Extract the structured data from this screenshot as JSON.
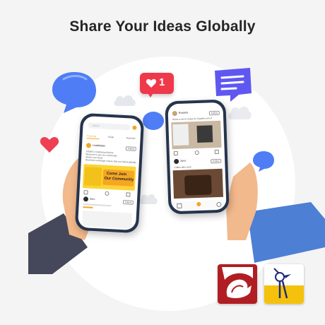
{
  "headline": "Share Your Ideas Globally",
  "colors": {
    "accent_orange": "#f5a623",
    "heart_red": "#f0384b",
    "bubble_blue": "#4f7df5",
    "chat_purple": "#5f58f0",
    "phone_frame": "#26344d"
  },
  "like_badge": {
    "count": "1"
  },
  "left_phone": {
    "search_placeholder": "Search",
    "tabs": [
      "Following",
      "Guide",
      "Featured"
    ],
    "post1": {
      "author": "LeadMatter",
      "follow_label": "Follow",
      "body_lines": [
        "SONEX | Intellectual Author",
        "Welcome to join our community",
        "Share your ideas",
        "Real-time exchange ensure that you follow globally"
      ]
    },
    "banner": {
      "line1": "Come Join",
      "line2": "Our Community"
    },
    "post2": {
      "author": "Zero",
      "follow_label": "Follow"
    }
  },
  "right_phone": {
    "post1": {
      "author": "Rosarita",
      "caption": "Share a set of recipe for Cigarile.com.cf",
      "follow_label": "Follow"
    },
    "post2": {
      "author": "Zeno",
      "caption": "Coffee after work",
      "follow_label": "Follow"
    }
  },
  "icons": [
    "like-heart-icon",
    "thumb-up-icon",
    "comment-icon",
    "share-icon",
    "home-icon",
    "add-post-icon",
    "profile-icon",
    "text-lines-icon"
  ]
}
